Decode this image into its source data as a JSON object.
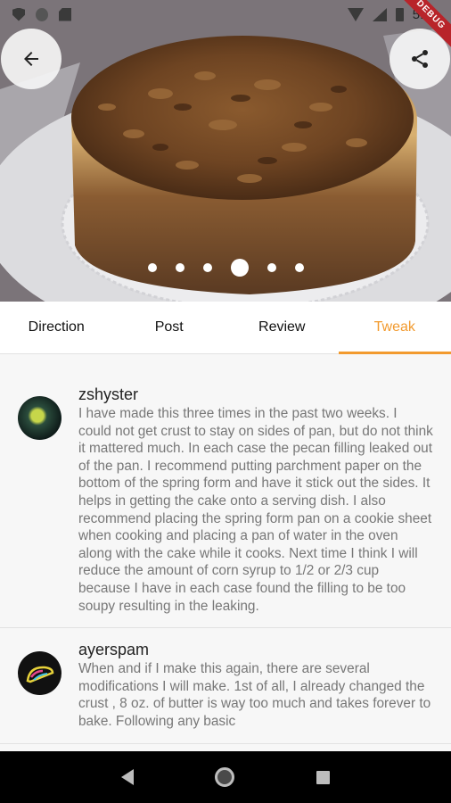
{
  "status_bar": {
    "time": "5:56"
  },
  "debug_banner": "DEBUG",
  "header": {
    "back_icon": "arrow-left-icon",
    "share_icon": "share-icon"
  },
  "carousel": {
    "dot_count": 6,
    "active_index": 3
  },
  "tabs": [
    {
      "label": "Direction",
      "active": false
    },
    {
      "label": "Post",
      "active": false
    },
    {
      "label": "Review",
      "active": false
    },
    {
      "label": "Tweak",
      "active": true
    }
  ],
  "colors": {
    "accent": "#f29a2e",
    "text_primary": "#222222",
    "text_secondary": "#777777"
  },
  "reviews": [
    {
      "username": "zshyster",
      "text": "I have made this three times in the past two weeks. I could not get crust to stay on sides of pan, but do not think it mattered much. In each case the pecan filling leaked out of the pan. I recommend putting parchment paper on the bottom of the spring form and have it stick out the sides. It helps in getting the cake onto a serving dish. I also recommend placing the spring form pan on a cookie sheet when cooking and placing a pan of water in the oven along with the cake while it cooks. Next time I think I will reduce the amount of corn syrup to 1/2 or 2/3 cup because I have in each case found the filling to be too soupy resulting in the leaking."
    },
    {
      "username": "ayerspam",
      "text": "When and if I make this again, there are several modifications I will make. 1st of all, I already changed the crust , 8 oz. of butter is way too much and takes forever to bake. Following any basic"
    }
  ]
}
